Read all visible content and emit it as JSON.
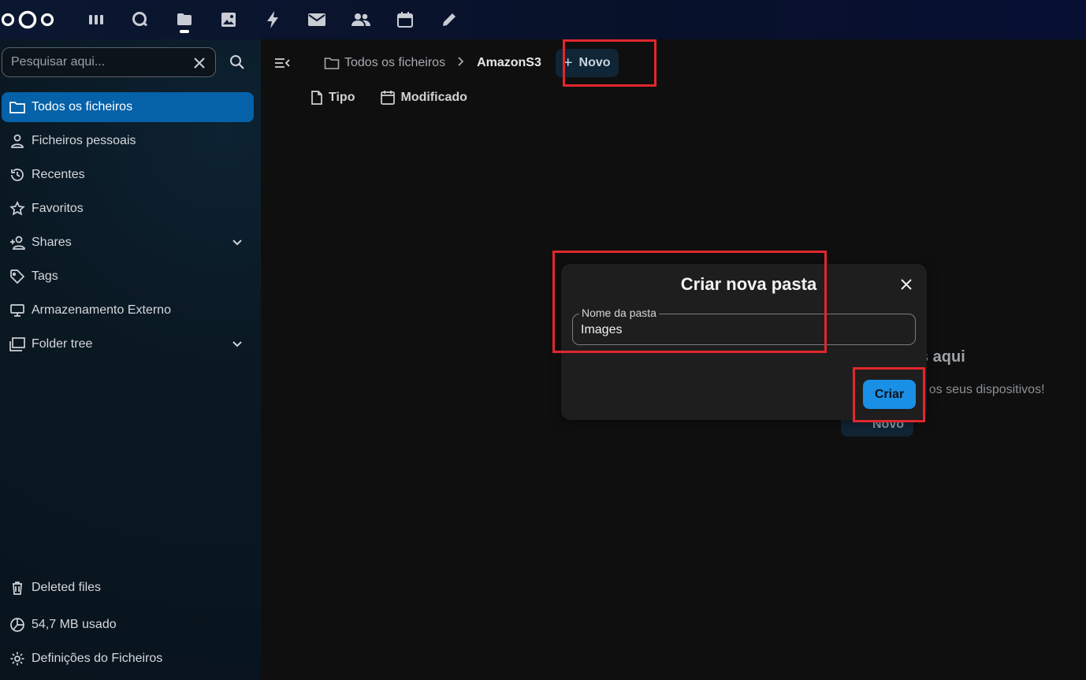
{
  "topbar": {
    "apps": [
      {
        "name": "dashboard-icon"
      },
      {
        "name": "circle-search-icon"
      },
      {
        "name": "files-icon"
      },
      {
        "name": "photos-icon"
      },
      {
        "name": "activity-icon"
      },
      {
        "name": "mail-icon"
      },
      {
        "name": "contacts-icon"
      },
      {
        "name": "calendar-icon"
      },
      {
        "name": "notes-icon"
      }
    ]
  },
  "sidebar": {
    "search_placeholder": "Pesquisar aqui...",
    "items": [
      {
        "label": "Todos os ficheiros",
        "icon": "folder-icon"
      },
      {
        "label": "Ficheiros pessoais",
        "icon": "person-icon"
      },
      {
        "label": "Recentes",
        "icon": "history-icon"
      },
      {
        "label": "Favoritos",
        "icon": "star-icon"
      },
      {
        "label": "Shares",
        "icon": "share-icon"
      },
      {
        "label": "Tags",
        "icon": "tag-icon"
      },
      {
        "label": "Armazenamento Externo",
        "icon": "monitor-icon"
      },
      {
        "label": "Folder tree",
        "icon": "folder-tree-icon"
      }
    ],
    "bottom": [
      {
        "label": "Deleted files",
        "icon": "trash-icon"
      },
      {
        "label": "54,7 MB usado",
        "icon": "pie-chart-icon"
      },
      {
        "label": "Definições do Ficheiros",
        "icon": "gear-icon"
      }
    ]
  },
  "breadcrumb": {
    "root": "Todos os ficheiros",
    "current": "AmazonS3",
    "new_label": "Novo"
  },
  "filters": {
    "type": "Tipo",
    "modified": "Modificado"
  },
  "empty": {
    "title_fragment": "s aqui",
    "subtitle_fragment": "m os seus dispositivos!",
    "new_label": "Novo"
  },
  "modal": {
    "title": "Criar nova pasta",
    "field_label": "Nome da pasta",
    "field_value": "Images",
    "create_label": "Criar"
  },
  "colors": {
    "accent": "#0561a8",
    "primary_button": "#1a8fe6",
    "highlight": "#e0272d"
  }
}
